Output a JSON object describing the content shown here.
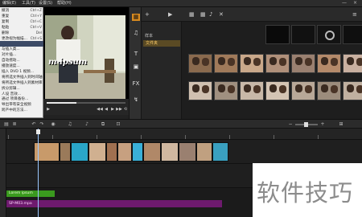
{
  "menubar": {
    "items": [
      "编辑(E)",
      "工具(T)",
      "设置(S)",
      "帮助(H)"
    ],
    "window_controls": [
      "—",
      "×"
    ]
  },
  "edit_menu": {
    "items": [
      {
        "label": "撤消",
        "shortcut": "Ctrl+Z"
      },
      {
        "label": "重复",
        "shortcut": "Ctrl+Y"
      },
      {
        "label": "复制",
        "shortcut": "Ctrl+C"
      },
      {
        "label": "粘贴",
        "shortcut": "Ctrl+V"
      },
      {
        "label": "删除",
        "shortcut": "Del"
      },
      {
        "label": "更改视为幅描...",
        "shortcut": "Ctrl+S"
      },
      {
        "label": "",
        "shortcut": ""
      },
      {
        "label": "与插入类...",
        "shortcut": ""
      },
      {
        "label": "对片插...",
        "shortcut": ""
      },
      {
        "label": "自动摇动...",
        "shortcut": ""
      },
      {
        "label": "播放速度...",
        "shortcut": ""
      },
      {
        "label": "插入 DVD 1 视频...",
        "shortcut": ""
      },
      {
        "label": "将所选文件插入到时间轴",
        "shortcut": ""
      },
      {
        "label": "将所选文件插入到素材库",
        "shortcut": ""
      },
      {
        "label": "拆分剪辑...",
        "shortcut": ""
      },
      {
        "label": "人设 音效...",
        "shortcut": ""
      },
      {
        "label": "通过 项目备份...",
        "shortcut": ""
      },
      {
        "label": "导出带有安全视频",
        "shortcut": ""
      },
      {
        "label": "跨产中的方法...",
        "shortcut": ""
      },
      {
        "label": "改为自适应入",
        "shortcut": ""
      }
    ]
  },
  "preview": {
    "title_overlay": "m ipsum",
    "progress": 0.38,
    "controls": [
      "▶",
      "◀◀",
      "◀",
      "▶",
      "▶▶",
      "⟲",
      "🔊",
      "HD"
    ]
  },
  "sidetools": [
    "▦",
    "♫",
    "T",
    "▣",
    "FX",
    "↯"
  ],
  "library": {
    "top_icons": [
      "+",
      "▶",
      "▦",
      "▦",
      "♪",
      "✕",
      "≡"
    ],
    "nav_labels": [
      "样本",
      "文件夹"
    ],
    "selected_nav": "文件夹",
    "thumbs": [
      {
        "caption": "",
        "color": "#0a0a0a"
      },
      {
        "caption": "",
        "color": "#111"
      },
      {
        "caption": "",
        "color": "#131313"
      },
      {
        "caption": "",
        "color": "#0f0f0f"
      },
      {
        "caption": "",
        "color": "#8a6a4e"
      },
      {
        "caption": "",
        "color": "#a07a5a"
      },
      {
        "caption": "",
        "color": "#c9a88a"
      },
      {
        "caption": "",
        "color": "#b0907a"
      },
      {
        "caption": "",
        "color": "#9a8070"
      },
      {
        "caption": "",
        "color": "#b48a6a"
      },
      {
        "caption": "",
        "color": "#c9b0a0"
      },
      {
        "caption": "",
        "color": "#d0c0b0"
      },
      {
        "caption": "",
        "color": "#a09080"
      },
      {
        "caption": "",
        "color": "#c8b8a8"
      },
      {
        "caption": "",
        "color": "#d4c4b4"
      },
      {
        "caption": "",
        "color": "#b8a898"
      },
      {
        "caption": "",
        "color": "#9c8c7c"
      },
      {
        "caption": "",
        "color": "#c0b0a0"
      },
      {
        "caption": "",
        "color": "#b0a090"
      }
    ]
  },
  "timeline": {
    "clips_colors": [
      "#c89a6a",
      "#9a7a5a",
      "#2aa6c8",
      "#d0b090",
      "#a07050",
      "#c7a080",
      "#3ab0d8",
      "#b08868",
      "#d0b8a0",
      "#9a8070",
      "#c0a080",
      "#3aa0c0"
    ],
    "title_clip": "Lorem ipsum",
    "music_clip": "SP-M03.mpa"
  },
  "watermark": "软件技巧"
}
